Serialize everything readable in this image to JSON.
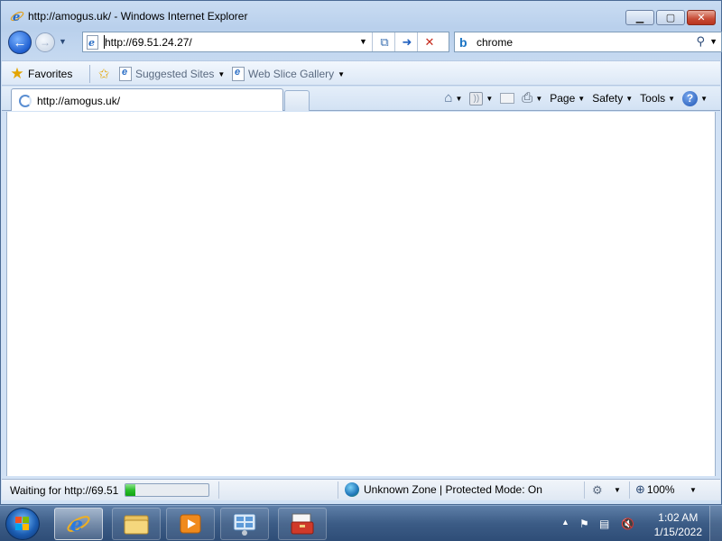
{
  "window": {
    "title": "http://amogus.uk/ - Windows Internet Explorer",
    "minimize_label": "",
    "maximize_label": "",
    "close_label": ""
  },
  "nav": {
    "address": "http://69.51.24.27/",
    "search_text": "chrome"
  },
  "favorites_bar": {
    "favorites_label": "Favorites",
    "links": [
      {
        "label": "Suggested Sites"
      },
      {
        "label": "Web Slice Gallery"
      }
    ]
  },
  "tabs": [
    {
      "label": "http://amogus.uk/"
    }
  ],
  "command_bar": {
    "page_label": "Page",
    "safety_label": "Safety",
    "tools_label": "Tools"
  },
  "status": {
    "text": "Waiting for http://69.51",
    "progress": 0.12,
    "zone": "Unknown Zone | Protected Mode: On",
    "zoom": "100%"
  },
  "taskbar": {
    "time": "1:02 AM",
    "date": "1/15/2022"
  },
  "colors": {
    "progress_green": "#2cbf2c",
    "close_red": "#c74a34"
  }
}
